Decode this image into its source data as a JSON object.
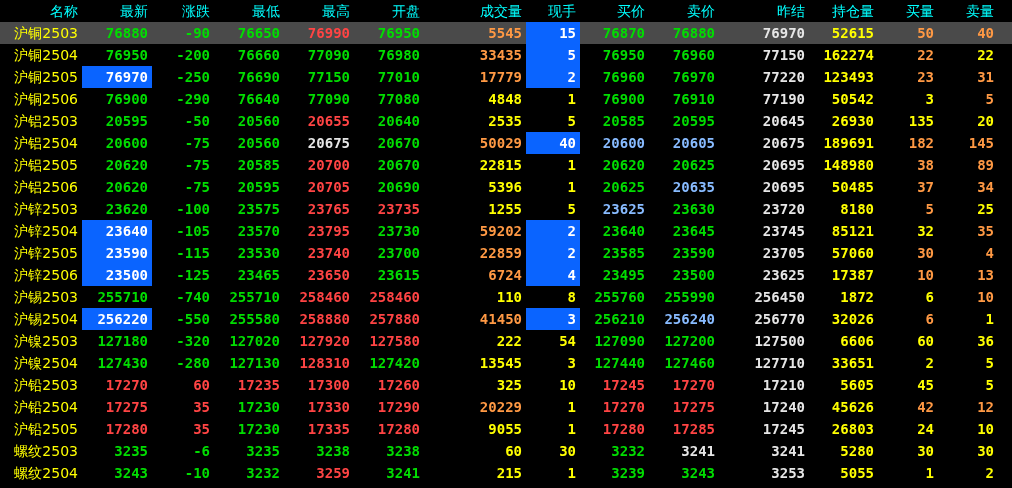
{
  "columns": [
    "名称",
    "最新",
    "涨跌",
    "最低",
    "最高",
    "开盘",
    "成交量",
    "现手",
    "买价",
    "卖价",
    "昨结",
    "持仓量",
    "买量",
    "卖量"
  ],
  "rows": [
    {
      "name": "沪铜2503",
      "selected": true,
      "cells": [
        {
          "text": "76880",
          "color": "#00dd00",
          "highlighted": false
        },
        {
          "text": "-90",
          "color": "#00dd00",
          "highlighted": false
        },
        {
          "text": "76650",
          "color": "#00dd00",
          "highlighted": false
        },
        {
          "text": "76990",
          "color": "#ff4444",
          "highlighted": false
        },
        {
          "text": "76950",
          "color": "#00dd00",
          "highlighted": false
        },
        {
          "text": "5545",
          "color": "#ff9944",
          "highlighted": false
        },
        {
          "text": "15",
          "color": "#ffffff",
          "highlighted": true
        },
        {
          "text": "76870",
          "color": "#00dd00",
          "highlighted": false
        },
        {
          "text": "76880",
          "color": "#00dd00",
          "highlighted": false
        },
        {
          "text": "76970",
          "color": "#e6e6e6",
          "highlighted": false
        },
        {
          "text": "52615",
          "color": "#ffff00",
          "highlighted": false
        },
        {
          "text": "50",
          "color": "#ff9944",
          "highlighted": false
        },
        {
          "text": "40",
          "color": "#ff9944",
          "highlighted": false
        }
      ]
    },
    {
      "name": "沪铜2504",
      "selected": false,
      "cells": [
        {
          "text": "76950",
          "color": "#00dd00",
          "highlighted": false
        },
        {
          "text": "-200",
          "color": "#00dd00",
          "highlighted": false
        },
        {
          "text": "76660",
          "color": "#00dd00",
          "highlighted": false
        },
        {
          "text": "77090",
          "color": "#00dd00",
          "highlighted": false
        },
        {
          "text": "76980",
          "color": "#00dd00",
          "highlighted": false
        },
        {
          "text": "33435",
          "color": "#ff9944",
          "highlighted": false
        },
        {
          "text": "5",
          "color": "#ffffff",
          "highlighted": true
        },
        {
          "text": "76950",
          "color": "#00dd00",
          "highlighted": false
        },
        {
          "text": "76960",
          "color": "#00dd00",
          "highlighted": false
        },
        {
          "text": "77150",
          "color": "#e6e6e6",
          "highlighted": false
        },
        {
          "text": "162274",
          "color": "#ffff00",
          "highlighted": false
        },
        {
          "text": "22",
          "color": "#ff9944",
          "highlighted": false
        },
        {
          "text": "22",
          "color": "#ffff00",
          "highlighted": false
        }
      ]
    },
    {
      "name": "沪铜2505",
      "selected": false,
      "cells": [
        {
          "text": "76970",
          "color": "#ffffff",
          "highlighted": true
        },
        {
          "text": "-250",
          "color": "#00dd00",
          "highlighted": false
        },
        {
          "text": "76690",
          "color": "#00dd00",
          "highlighted": false
        },
        {
          "text": "77150",
          "color": "#00dd00",
          "highlighted": false
        },
        {
          "text": "77010",
          "color": "#00dd00",
          "highlighted": false
        },
        {
          "text": "17779",
          "color": "#ff9944",
          "highlighted": false
        },
        {
          "text": "2",
          "color": "#ffffff",
          "highlighted": true
        },
        {
          "text": "76960",
          "color": "#00dd00",
          "highlighted": false
        },
        {
          "text": "76970",
          "color": "#00dd00",
          "highlighted": false
        },
        {
          "text": "77220",
          "color": "#e6e6e6",
          "highlighted": false
        },
        {
          "text": "123493",
          "color": "#ffff00",
          "highlighted": false
        },
        {
          "text": "23",
          "color": "#ff9944",
          "highlighted": false
        },
        {
          "text": "31",
          "color": "#ff9944",
          "highlighted": false
        }
      ]
    },
    {
      "name": "沪铜2506",
      "selected": false,
      "cells": [
        {
          "text": "76900",
          "color": "#00dd00",
          "highlighted": false
        },
        {
          "text": "-290",
          "color": "#00dd00",
          "highlighted": false
        },
        {
          "text": "76640",
          "color": "#00dd00",
          "highlighted": false
        },
        {
          "text": "77090",
          "color": "#00dd00",
          "highlighted": false
        },
        {
          "text": "77080",
          "color": "#00dd00",
          "highlighted": false
        },
        {
          "text": "4848",
          "color": "#ffff00",
          "highlighted": false
        },
        {
          "text": "1",
          "color": "#ffff00",
          "highlighted": false
        },
        {
          "text": "76900",
          "color": "#00dd00",
          "highlighted": false
        },
        {
          "text": "76910",
          "color": "#00dd00",
          "highlighted": false
        },
        {
          "text": "77190",
          "color": "#e6e6e6",
          "highlighted": false
        },
        {
          "text": "50542",
          "color": "#ffff00",
          "highlighted": false
        },
        {
          "text": "3",
          "color": "#ffff00",
          "highlighted": false
        },
        {
          "text": "5",
          "color": "#ff9944",
          "highlighted": false
        }
      ]
    },
    {
      "name": "沪铝2503",
      "selected": false,
      "cells": [
        {
          "text": "20595",
          "color": "#00dd00",
          "highlighted": false
        },
        {
          "text": "-50",
          "color": "#00dd00",
          "highlighted": false
        },
        {
          "text": "20560",
          "color": "#00dd00",
          "highlighted": false
        },
        {
          "text": "20655",
          "color": "#ff4444",
          "highlighted": false
        },
        {
          "text": "20640",
          "color": "#00dd00",
          "highlighted": false
        },
        {
          "text": "2535",
          "color": "#ffff00",
          "highlighted": false
        },
        {
          "text": "5",
          "color": "#ffff00",
          "highlighted": false
        },
        {
          "text": "20585",
          "color": "#00dd00",
          "highlighted": false
        },
        {
          "text": "20595",
          "color": "#00dd00",
          "highlighted": false
        },
        {
          "text": "20645",
          "color": "#e6e6e6",
          "highlighted": false
        },
        {
          "text": "26930",
          "color": "#ffff00",
          "highlighted": false
        },
        {
          "text": "135",
          "color": "#ffff00",
          "highlighted": false
        },
        {
          "text": "20",
          "color": "#ffff00",
          "highlighted": false
        }
      ]
    },
    {
      "name": "沪铝2504",
      "selected": false,
      "cells": [
        {
          "text": "20600",
          "color": "#00dd00",
          "highlighted": false
        },
        {
          "text": "-75",
          "color": "#00dd00",
          "highlighted": false
        },
        {
          "text": "20560",
          "color": "#00dd00",
          "highlighted": false
        },
        {
          "text": "20675",
          "color": "#e6e6e6",
          "highlighted": false
        },
        {
          "text": "20670",
          "color": "#00dd00",
          "highlighted": false
        },
        {
          "text": "50029",
          "color": "#ff9944",
          "highlighted": false
        },
        {
          "text": "40",
          "color": "#ffffff",
          "highlighted": true
        },
        {
          "text": "20600",
          "color": "#88bbff",
          "highlighted": false
        },
        {
          "text": "20605",
          "color": "#88bbff",
          "highlighted": false
        },
        {
          "text": "20675",
          "color": "#e6e6e6",
          "highlighted": false
        },
        {
          "text": "189691",
          "color": "#ffff00",
          "highlighted": false
        },
        {
          "text": "182",
          "color": "#ff9944",
          "highlighted": false
        },
        {
          "text": "145",
          "color": "#ff9944",
          "highlighted": false
        }
      ]
    },
    {
      "name": "沪铝2505",
      "selected": false,
      "cells": [
        {
          "text": "20620",
          "color": "#00dd00",
          "highlighted": false
        },
        {
          "text": "-75",
          "color": "#00dd00",
          "highlighted": false
        },
        {
          "text": "20585",
          "color": "#00dd00",
          "highlighted": false
        },
        {
          "text": "20700",
          "color": "#ff4444",
          "highlighted": false
        },
        {
          "text": "20670",
          "color": "#00dd00",
          "highlighted": false
        },
        {
          "text": "22815",
          "color": "#ffff00",
          "highlighted": false
        },
        {
          "text": "1",
          "color": "#ffff00",
          "highlighted": false
        },
        {
          "text": "20620",
          "color": "#00dd00",
          "highlighted": false
        },
        {
          "text": "20625",
          "color": "#00dd00",
          "highlighted": false
        },
        {
          "text": "20695",
          "color": "#e6e6e6",
          "highlighted": false
        },
        {
          "text": "148980",
          "color": "#ffff00",
          "highlighted": false
        },
        {
          "text": "38",
          "color": "#ff9944",
          "highlighted": false
        },
        {
          "text": "89",
          "color": "#ff9944",
          "highlighted": false
        }
      ]
    },
    {
      "name": "沪铝2506",
      "selected": false,
      "cells": [
        {
          "text": "20620",
          "color": "#00dd00",
          "highlighted": false
        },
        {
          "text": "-75",
          "color": "#00dd00",
          "highlighted": false
        },
        {
          "text": "20595",
          "color": "#00dd00",
          "highlighted": false
        },
        {
          "text": "20705",
          "color": "#ff4444",
          "highlighted": false
        },
        {
          "text": "20690",
          "color": "#00dd00",
          "highlighted": false
        },
        {
          "text": "5396",
          "color": "#ffff00",
          "highlighted": false
        },
        {
          "text": "1",
          "color": "#ffff00",
          "highlighted": false
        },
        {
          "text": "20625",
          "color": "#00dd00",
          "highlighted": false
        },
        {
          "text": "20635",
          "color": "#88bbff",
          "highlighted": false
        },
        {
          "text": "20695",
          "color": "#e6e6e6",
          "highlighted": false
        },
        {
          "text": "50485",
          "color": "#ffff00",
          "highlighted": false
        },
        {
          "text": "37",
          "color": "#ff9944",
          "highlighted": false
        },
        {
          "text": "34",
          "color": "#ff9944",
          "highlighted": false
        }
      ]
    },
    {
      "name": "沪锌2503",
      "selected": false,
      "cells": [
        {
          "text": "23620",
          "color": "#00dd00",
          "highlighted": false
        },
        {
          "text": "-100",
          "color": "#00dd00",
          "highlighted": false
        },
        {
          "text": "23575",
          "color": "#00dd00",
          "highlighted": false
        },
        {
          "text": "23765",
          "color": "#ff4444",
          "highlighted": false
        },
        {
          "text": "23735",
          "color": "#ff4444",
          "highlighted": false
        },
        {
          "text": "1255",
          "color": "#ffff00",
          "highlighted": false
        },
        {
          "text": "5",
          "color": "#ffff00",
          "highlighted": false
        },
        {
          "text": "23625",
          "color": "#88bbff",
          "highlighted": false
        },
        {
          "text": "23630",
          "color": "#00dd00",
          "highlighted": false
        },
        {
          "text": "23720",
          "color": "#e6e6e6",
          "highlighted": false
        },
        {
          "text": "8180",
          "color": "#ffff00",
          "highlighted": false
        },
        {
          "text": "5",
          "color": "#ff9944",
          "highlighted": false
        },
        {
          "text": "25",
          "color": "#ffff00",
          "highlighted": false
        }
      ]
    },
    {
      "name": "沪锌2504",
      "selected": false,
      "cells": [
        {
          "text": "23640",
          "color": "#ffffff",
          "highlighted": true
        },
        {
          "text": "-105",
          "color": "#00dd00",
          "highlighted": false
        },
        {
          "text": "23570",
          "color": "#00dd00",
          "highlighted": false
        },
        {
          "text": "23795",
          "color": "#ff4444",
          "highlighted": false
        },
        {
          "text": "23730",
          "color": "#00dd00",
          "highlighted": false
        },
        {
          "text": "59202",
          "color": "#ff9944",
          "highlighted": false
        },
        {
          "text": "2",
          "color": "#ffffff",
          "highlighted": true
        },
        {
          "text": "23640",
          "color": "#00dd00",
          "highlighted": false
        },
        {
          "text": "23645",
          "color": "#00dd00",
          "highlighted": false
        },
        {
          "text": "23745",
          "color": "#e6e6e6",
          "highlighted": false
        },
        {
          "text": "85121",
          "color": "#ffff00",
          "highlighted": false
        },
        {
          "text": "32",
          "color": "#ffff00",
          "highlighted": false
        },
        {
          "text": "35",
          "color": "#ff9944",
          "highlighted": false
        }
      ]
    },
    {
      "name": "沪锌2505",
      "selected": false,
      "cells": [
        {
          "text": "23590",
          "color": "#ffffff",
          "highlighted": true
        },
        {
          "text": "-115",
          "color": "#00dd00",
          "highlighted": false
        },
        {
          "text": "23530",
          "color": "#00dd00",
          "highlighted": false
        },
        {
          "text": "23740",
          "color": "#ff4444",
          "highlighted": false
        },
        {
          "text": "23700",
          "color": "#00dd00",
          "highlighted": false
        },
        {
          "text": "22859",
          "color": "#ff9944",
          "highlighted": false
        },
        {
          "text": "2",
          "color": "#ffffff",
          "highlighted": true
        },
        {
          "text": "23585",
          "color": "#00dd00",
          "highlighted": false
        },
        {
          "text": "23590",
          "color": "#00dd00",
          "highlighted": false
        },
        {
          "text": "23705",
          "color": "#e6e6e6",
          "highlighted": false
        },
        {
          "text": "57060",
          "color": "#ffff00",
          "highlighted": false
        },
        {
          "text": "30",
          "color": "#ff9944",
          "highlighted": false
        },
        {
          "text": "4",
          "color": "#ff9944",
          "highlighted": false
        }
      ]
    },
    {
      "name": "沪锌2506",
      "selected": false,
      "cells": [
        {
          "text": "23500",
          "color": "#ffffff",
          "highlighted": true
        },
        {
          "text": "-125",
          "color": "#00dd00",
          "highlighted": false
        },
        {
          "text": "23465",
          "color": "#00dd00",
          "highlighted": false
        },
        {
          "text": "23650",
          "color": "#ff4444",
          "highlighted": false
        },
        {
          "text": "23615",
          "color": "#00dd00",
          "highlighted": false
        },
        {
          "text": "6724",
          "color": "#ff9944",
          "highlighted": false
        },
        {
          "text": "4",
          "color": "#ffffff",
          "highlighted": true
        },
        {
          "text": "23495",
          "color": "#00dd00",
          "highlighted": false
        },
        {
          "text": "23500",
          "color": "#00dd00",
          "highlighted": false
        },
        {
          "text": "23625",
          "color": "#e6e6e6",
          "highlighted": false
        },
        {
          "text": "17387",
          "color": "#ffff00",
          "highlighted": false
        },
        {
          "text": "10",
          "color": "#ff9944",
          "highlighted": false
        },
        {
          "text": "13",
          "color": "#ff9944",
          "highlighted": false
        }
      ]
    },
    {
      "name": "沪锡2503",
      "selected": false,
      "cells": [
        {
          "text": "255710",
          "color": "#00dd00",
          "highlighted": false
        },
        {
          "text": "-740",
          "color": "#00dd00",
          "highlighted": false
        },
        {
          "text": "255710",
          "color": "#00dd00",
          "highlighted": false
        },
        {
          "text": "258460",
          "color": "#ff4444",
          "highlighted": false
        },
        {
          "text": "258460",
          "color": "#ff4444",
          "highlighted": false
        },
        {
          "text": "110",
          "color": "#ffff00",
          "highlighted": false
        },
        {
          "text": "8",
          "color": "#ffff00",
          "highlighted": false
        },
        {
          "text": "255760",
          "color": "#00dd00",
          "highlighted": false
        },
        {
          "text": "255990",
          "color": "#00dd00",
          "highlighted": false
        },
        {
          "text": "256450",
          "color": "#e6e6e6",
          "highlighted": false
        },
        {
          "text": "1872",
          "color": "#ffff00",
          "highlighted": false
        },
        {
          "text": "6",
          "color": "#ffff00",
          "highlighted": false
        },
        {
          "text": "10",
          "color": "#ff9944",
          "highlighted": false
        }
      ]
    },
    {
      "name": "沪锡2504",
      "selected": false,
      "cells": [
        {
          "text": "256220",
          "color": "#ffffff",
          "highlighted": true
        },
        {
          "text": "-550",
          "color": "#00dd00",
          "highlighted": false
        },
        {
          "text": "255580",
          "color": "#00dd00",
          "highlighted": false
        },
        {
          "text": "258880",
          "color": "#ff4444",
          "highlighted": false
        },
        {
          "text": "257880",
          "color": "#ff4444",
          "highlighted": false
        },
        {
          "text": "41450",
          "color": "#ff9944",
          "highlighted": false
        },
        {
          "text": "3",
          "color": "#ffffff",
          "highlighted": true
        },
        {
          "text": "256210",
          "color": "#00dd00",
          "highlighted": false
        },
        {
          "text": "256240",
          "color": "#88bbff",
          "highlighted": false
        },
        {
          "text": "256770",
          "color": "#e6e6e6",
          "highlighted": false
        },
        {
          "text": "32026",
          "color": "#ffff00",
          "highlighted": false
        },
        {
          "text": "6",
          "color": "#ff9944",
          "highlighted": false
        },
        {
          "text": "1",
          "color": "#ffff00",
          "highlighted": false
        }
      ]
    },
    {
      "name": "沪镍2503",
      "selected": false,
      "cells": [
        {
          "text": "127180",
          "color": "#00dd00",
          "highlighted": false
        },
        {
          "text": "-320",
          "color": "#00dd00",
          "highlighted": false
        },
        {
          "text": "127020",
          "color": "#00dd00",
          "highlighted": false
        },
        {
          "text": "127920",
          "color": "#ff4444",
          "highlighted": false
        },
        {
          "text": "127580",
          "color": "#ff4444",
          "highlighted": false
        },
        {
          "text": "222",
          "color": "#ffff00",
          "highlighted": false
        },
        {
          "text": "54",
          "color": "#ffff00",
          "highlighted": false
        },
        {
          "text": "127090",
          "color": "#00dd00",
          "highlighted": false
        },
        {
          "text": "127200",
          "color": "#00dd00",
          "highlighted": false
        },
        {
          "text": "127500",
          "color": "#e6e6e6",
          "highlighted": false
        },
        {
          "text": "6606",
          "color": "#ffff00",
          "highlighted": false
        },
        {
          "text": "60",
          "color": "#ffff00",
          "highlighted": false
        },
        {
          "text": "36",
          "color": "#ffff00",
          "highlighted": false
        }
      ]
    },
    {
      "name": "沪镍2504",
      "selected": false,
      "cells": [
        {
          "text": "127430",
          "color": "#00dd00",
          "highlighted": false
        },
        {
          "text": "-280",
          "color": "#00dd00",
          "highlighted": false
        },
        {
          "text": "127130",
          "color": "#00dd00",
          "highlighted": false
        },
        {
          "text": "128310",
          "color": "#ff4444",
          "highlighted": false
        },
        {
          "text": "127420",
          "color": "#00dd00",
          "highlighted": false
        },
        {
          "text": "13545",
          "color": "#ffff00",
          "highlighted": false
        },
        {
          "text": "3",
          "color": "#ffff00",
          "highlighted": false
        },
        {
          "text": "127440",
          "color": "#00dd00",
          "highlighted": false
        },
        {
          "text": "127460",
          "color": "#00dd00",
          "highlighted": false
        },
        {
          "text": "127710",
          "color": "#e6e6e6",
          "highlighted": false
        },
        {
          "text": "33651",
          "color": "#ffff00",
          "highlighted": false
        },
        {
          "text": "2",
          "color": "#ffff00",
          "highlighted": false
        },
        {
          "text": "5",
          "color": "#ffff00",
          "highlighted": false
        }
      ]
    },
    {
      "name": "沪铅2503",
      "selected": false,
      "cells": [
        {
          "text": "17270",
          "color": "#ff4444",
          "highlighted": false
        },
        {
          "text": "60",
          "color": "#ff4444",
          "highlighted": false
        },
        {
          "text": "17235",
          "color": "#ff4444",
          "highlighted": false
        },
        {
          "text": "17300",
          "color": "#ff4444",
          "highlighted": false
        },
        {
          "text": "17260",
          "color": "#ff4444",
          "highlighted": false
        },
        {
          "text": "325",
          "color": "#ffff00",
          "highlighted": false
        },
        {
          "text": "10",
          "color": "#ffff00",
          "highlighted": false
        },
        {
          "text": "17245",
          "color": "#ff4444",
          "highlighted": false
        },
        {
          "text": "17270",
          "color": "#ff4444",
          "highlighted": false
        },
        {
          "text": "17210",
          "color": "#e6e6e6",
          "highlighted": false
        },
        {
          "text": "5605",
          "color": "#ffff00",
          "highlighted": false
        },
        {
          "text": "45",
          "color": "#ffff00",
          "highlighted": false
        },
        {
          "text": "5",
          "color": "#ffff00",
          "highlighted": false
        }
      ]
    },
    {
      "name": "沪铅2504",
      "selected": false,
      "cells": [
        {
          "text": "17275",
          "color": "#ff4444",
          "highlighted": false
        },
        {
          "text": "35",
          "color": "#ff4444",
          "highlighted": false
        },
        {
          "text": "17230",
          "color": "#00dd00",
          "highlighted": false
        },
        {
          "text": "17330",
          "color": "#ff4444",
          "highlighted": false
        },
        {
          "text": "17290",
          "color": "#ff4444",
          "highlighted": false
        },
        {
          "text": "20229",
          "color": "#ff9944",
          "highlighted": false
        },
        {
          "text": "1",
          "color": "#ffff00",
          "highlighted": false
        },
        {
          "text": "17270",
          "color": "#ff4444",
          "highlighted": false
        },
        {
          "text": "17275",
          "color": "#ff4444",
          "highlighted": false
        },
        {
          "text": "17240",
          "color": "#e6e6e6",
          "highlighted": false
        },
        {
          "text": "45626",
          "color": "#ffff00",
          "highlighted": false
        },
        {
          "text": "42",
          "color": "#ff9944",
          "highlighted": false
        },
        {
          "text": "12",
          "color": "#ff9944",
          "highlighted": false
        }
      ]
    },
    {
      "name": "沪铅2505",
      "selected": false,
      "cells": [
        {
          "text": "17280",
          "color": "#ff4444",
          "highlighted": false
        },
        {
          "text": "35",
          "color": "#ff4444",
          "highlighted": false
        },
        {
          "text": "17230",
          "color": "#00dd00",
          "highlighted": false
        },
        {
          "text": "17335",
          "color": "#ff4444",
          "highlighted": false
        },
        {
          "text": "17280",
          "color": "#ff4444",
          "highlighted": false
        },
        {
          "text": "9055",
          "color": "#ffff00",
          "highlighted": false
        },
        {
          "text": "1",
          "color": "#ffff00",
          "highlighted": false
        },
        {
          "text": "17280",
          "color": "#ff4444",
          "highlighted": false
        },
        {
          "text": "17285",
          "color": "#ff4444",
          "highlighted": false
        },
        {
          "text": "17245",
          "color": "#e6e6e6",
          "highlighted": false
        },
        {
          "text": "26803",
          "color": "#ffff00",
          "highlighted": false
        },
        {
          "text": "24",
          "color": "#ffff00",
          "highlighted": false
        },
        {
          "text": "10",
          "color": "#ffff00",
          "highlighted": false
        }
      ]
    },
    {
      "name": "螺纹2503",
      "selected": false,
      "cells": [
        {
          "text": "3235",
          "color": "#00dd00",
          "highlighted": false
        },
        {
          "text": "-6",
          "color": "#00dd00",
          "highlighted": false
        },
        {
          "text": "3235",
          "color": "#00dd00",
          "highlighted": false
        },
        {
          "text": "3238",
          "color": "#00dd00",
          "highlighted": false
        },
        {
          "text": "3238",
          "color": "#00dd00",
          "highlighted": false
        },
        {
          "text": "60",
          "color": "#ffff00",
          "highlighted": false
        },
        {
          "text": "30",
          "color": "#ffff00",
          "highlighted": false
        },
        {
          "text": "3232",
          "color": "#00dd00",
          "highlighted": false
        },
        {
          "text": "3241",
          "color": "#e6e6e6",
          "highlighted": false
        },
        {
          "text": "3241",
          "color": "#e6e6e6",
          "highlighted": false
        },
        {
          "text": "5280",
          "color": "#ffff00",
          "highlighted": false
        },
        {
          "text": "30",
          "color": "#ffff00",
          "highlighted": false
        },
        {
          "text": "30",
          "color": "#ffff00",
          "highlighted": false
        }
      ]
    },
    {
      "name": "螺纹2504",
      "selected": false,
      "cells": [
        {
          "text": "3243",
          "color": "#00dd00",
          "highlighted": false
        },
        {
          "text": "-10",
          "color": "#00dd00",
          "highlighted": false
        },
        {
          "text": "3232",
          "color": "#00dd00",
          "highlighted": false
        },
        {
          "text": "3259",
          "color": "#ff4444",
          "highlighted": false
        },
        {
          "text": "3241",
          "color": "#00dd00",
          "highlighted": false
        },
        {
          "text": "215",
          "color": "#ffff00",
          "highlighted": false
        },
        {
          "text": "1",
          "color": "#ffff00",
          "highlighted": false
        },
        {
          "text": "3239",
          "color": "#00dd00",
          "highlighted": false
        },
        {
          "text": "3243",
          "color": "#00dd00",
          "highlighted": false
        },
        {
          "text": "3253",
          "color": "#e6e6e6",
          "highlighted": false
        },
        {
          "text": "5055",
          "color": "#ffff00",
          "highlighted": false
        },
        {
          "text": "1",
          "color": "#ffff00",
          "highlighted": false
        },
        {
          "text": "2",
          "color": "#ffff00",
          "highlighted": false
        }
      ]
    }
  ]
}
